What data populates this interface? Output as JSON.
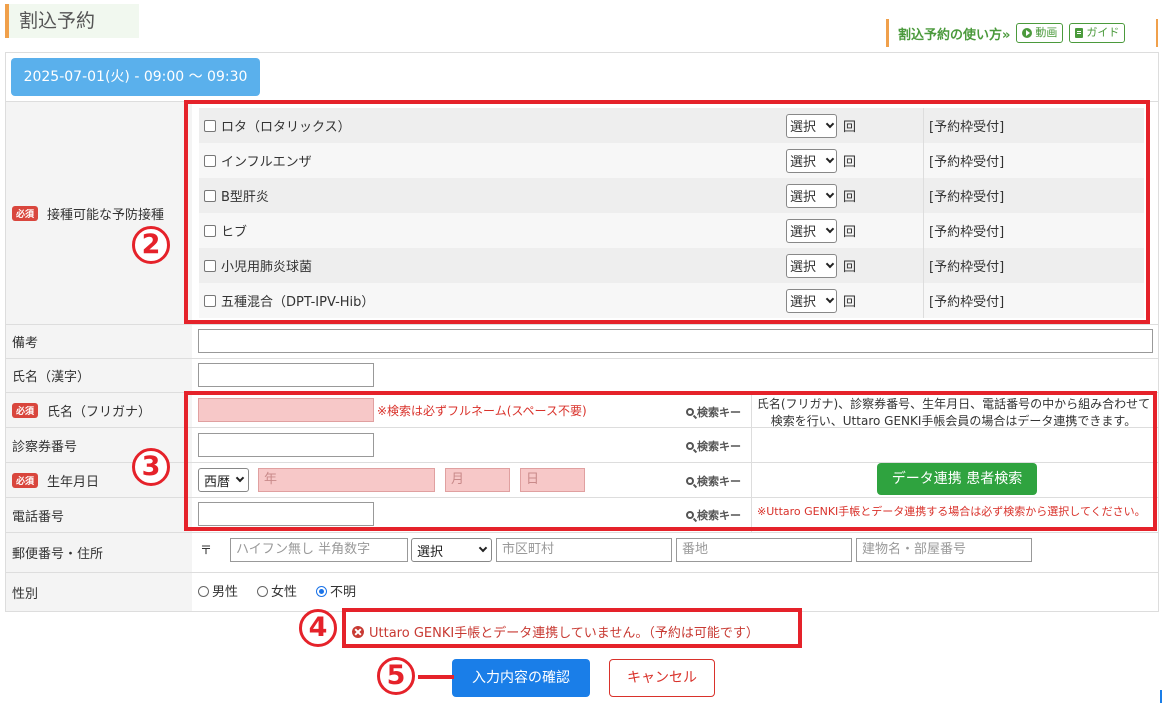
{
  "page": {
    "title": "割込予約"
  },
  "help": {
    "link": "割込予約の使い方»",
    "video": "動画",
    "guide": "ガイド"
  },
  "slot": {
    "datetime": "2025-07-01(火) - 09:00 〜 09:30"
  },
  "labels": {
    "required": "必須",
    "vaccines": "接種可能な予防接種",
    "notes": "備考",
    "name_kanji": "氏名（漢字）",
    "name_kana": "氏名（フリガナ）",
    "card_number": "診察券番号",
    "birthdate": "生年月日",
    "phone": "電話番号",
    "address": "郵便番号・住所",
    "gender": "性別"
  },
  "vaccines": [
    {
      "name": "ロタ（ロタリックス）",
      "select": "選択",
      "unit": "回",
      "status": "[予約枠受付]"
    },
    {
      "name": "インフルエンザ",
      "select": "選択",
      "unit": "回",
      "status": "[予約枠受付]"
    },
    {
      "name": "B型肝炎",
      "select": "選択",
      "unit": "回",
      "status": "[予約枠受付]"
    },
    {
      "name": "ヒブ",
      "select": "選択",
      "unit": "回",
      "status": "[予約枠受付]"
    },
    {
      "name": "小児用肺炎球菌",
      "select": "選択",
      "unit": "回",
      "status": "[予約枠受付]"
    },
    {
      "name": "五種混合（DPT-IPV-Hib）",
      "select": "選択",
      "unit": "回",
      "status": "[予約枠受付]"
    }
  ],
  "search": {
    "search_key": "検索キー",
    "fullname_hint": "※検索は必ずフルネーム(スペース不要)",
    "era": "西暦",
    "year_ph": "年",
    "month_ph": "月",
    "day_ph": "日",
    "description": "氏名(フリガナ)、診察券番号、生年月日、電話番号の中から組み合わせて検索を行い、Uttaro GENKI手帳会員の場合はデータ連携できます。",
    "patient_search_button": "データ連携 患者検索",
    "link_notice": "※Uttaro GENKI手帳とデータ連携する場合は必ず検索から選択してください。"
  },
  "address": {
    "postal_mark": "〒",
    "postal_ph": "ハイフン無し 半角数字",
    "prefecture": "選択",
    "city_ph": "市区町村",
    "street_ph": "番地",
    "building_ph": "建物名・部屋番号"
  },
  "gender": {
    "options": [
      "男性",
      "女性",
      "不明"
    ],
    "selected": "不明"
  },
  "warning": {
    "text": "Uttaro GENKI手帳とデータ連携していません。（予約は可能です）"
  },
  "actions": {
    "confirm": "入力内容の確認",
    "cancel": "キャンセル"
  },
  "annotations": {
    "n2": "2",
    "n3": "3",
    "n4": "4",
    "n5": "5"
  },
  "colors": {
    "accent_blue": "#1a7ee8",
    "date_blue": "#5ab0ec",
    "green": "#2fa33f",
    "required_red": "#d9463d",
    "highlight_red": "#e5222a"
  }
}
